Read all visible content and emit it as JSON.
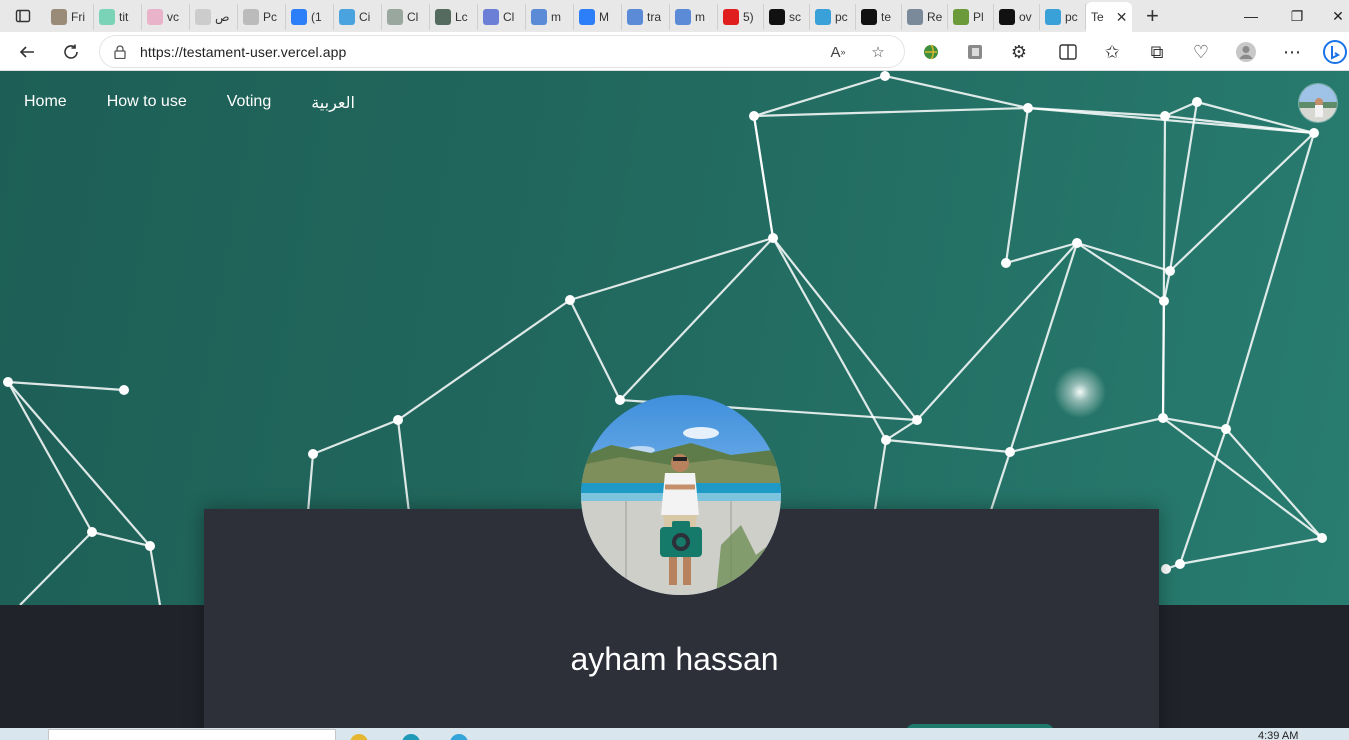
{
  "browser": {
    "tabs": [
      {
        "label": "Fri",
        "icon": "image-tab-icon",
        "color": "#9a8a78"
      },
      {
        "label": "tit",
        "icon": "circle-tab-icon",
        "color": "#7ad3b6"
      },
      {
        "label": "vc",
        "icon": "wc-tab-icon",
        "color": "#e9b3c9"
      },
      {
        "label": "ص",
        "icon": "mail-tab-icon",
        "color": "#cccccc"
      },
      {
        "label": "Pc",
        "icon": "page-tab-icon",
        "color": "#bbbbbb"
      },
      {
        "label": "(1",
        "icon": "meta-tab-icon",
        "color": "#2d7ff9"
      },
      {
        "label": "Ci",
        "icon": "codeium-tab-icon",
        "color": "#4aa3df"
      },
      {
        "label": "Cl",
        "icon": "openai-tab-icon",
        "color": "#9aa79f"
      },
      {
        "label": "Lc",
        "icon": "leaf-tab-icon",
        "color": "#556b5f"
      },
      {
        "label": "Cl",
        "icon": "cloud-tab-icon",
        "color": "#6b7fd6"
      },
      {
        "label": "m",
        "icon": "search-tab-icon",
        "color": "#5b8bd6"
      },
      {
        "label": "M",
        "icon": "meta-tab-icon",
        "color": "#2d7ff9"
      },
      {
        "label": "tra",
        "icon": "search-tab-icon",
        "color": "#5b8bd6"
      },
      {
        "label": "m",
        "icon": "search-tab-icon",
        "color": "#5b8bd6"
      },
      {
        "label": "5)",
        "icon": "youtube-tab-icon",
        "color": "#e01e1e"
      },
      {
        "label": "sc",
        "icon": "github-tab-icon",
        "color": "#111111"
      },
      {
        "label": "pc",
        "icon": "globe-tab-icon",
        "color": "#3aa0d8"
      },
      {
        "label": "te",
        "icon": "app-tab-icon",
        "color": "#111111"
      },
      {
        "label": "Re",
        "icon": "react-tab-icon",
        "color": "#7b8a9a"
      },
      {
        "label": "Pl",
        "icon": "chess-tab-icon",
        "color": "#6a9a3a"
      },
      {
        "label": "ov",
        "icon": "github-tab-icon",
        "color": "#111111"
      },
      {
        "label": "pc",
        "icon": "globe-tab-icon",
        "color": "#3aa0d8"
      }
    ],
    "active_tab": {
      "label": "Te"
    },
    "url": "https://testament-user.vercel.app"
  },
  "nav": {
    "home": "Home",
    "how_to_use": "How to use",
    "voting": "Voting",
    "arabic": "العربية"
  },
  "profile": {
    "name": "ayham hassan"
  },
  "taskbar": {
    "time": "4:39 AM"
  },
  "colors": {
    "hero_bg": "#22695f",
    "card_bg": "#2d2f39",
    "page_bg": "#21232b",
    "accent": "#1f7a6c"
  }
}
